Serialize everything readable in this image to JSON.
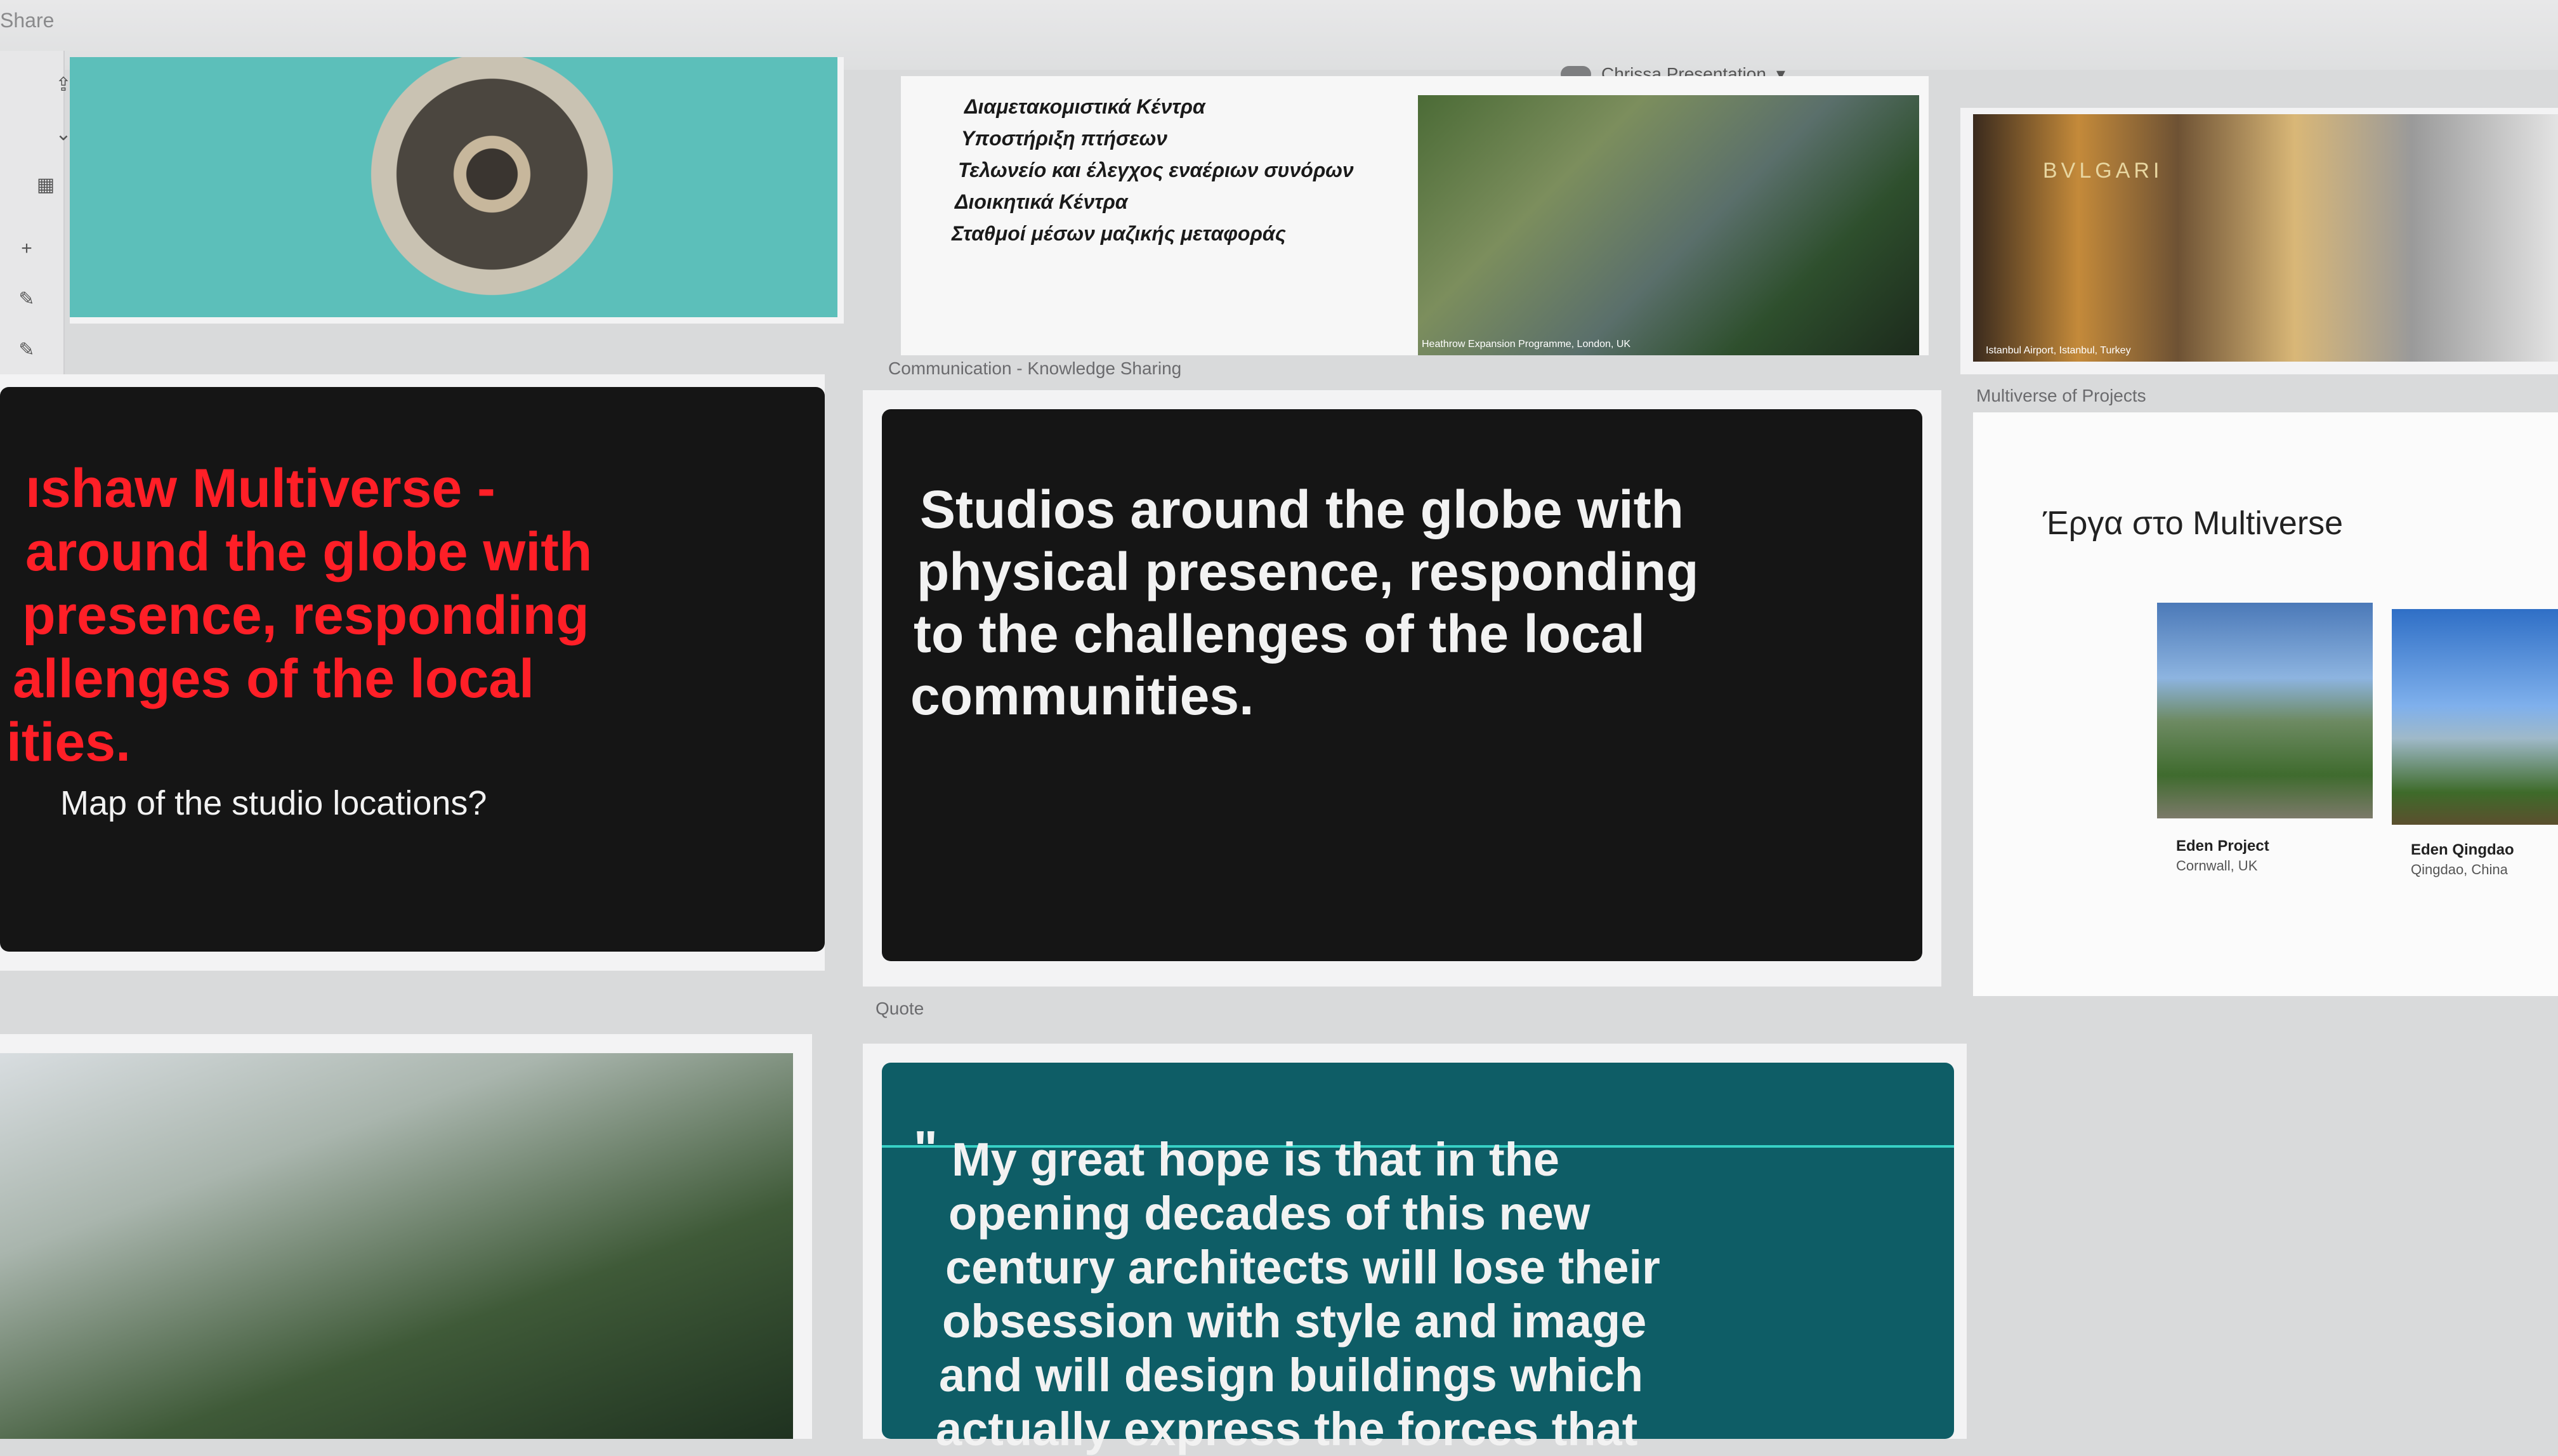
{
  "app": {
    "share_label": "Share",
    "document_name": "Chrissa Presentation"
  },
  "sections": {
    "communication": "Communication - Knowledge Sharing",
    "multiverse": "Multiverse of Projects",
    "quote": "Quote"
  },
  "slide_list": {
    "items": [
      "Διαμετακομιστικά Κέντρα",
      "Υποστήριξη πτήσεων",
      "Τελωνείο και έλεγχος εναέριων συνόρων",
      "Διοικητικά Κέντρα",
      "Σταθμοί μέσων μαζικής μεταφοράς"
    ]
  },
  "slide_red": {
    "lines": [
      "ıshaw Multiverse -",
      "around the globe with",
      "presence, responding",
      "allenges of the local",
      "ities."
    ],
    "subtitle": "Map of the studio locations?"
  },
  "slide_studios": {
    "lines": [
      "Studios around the globe with",
      "physical presence, responding",
      "to the challenges of the local",
      "communities."
    ]
  },
  "slide_projects": {
    "title": "Έργα στο Multiverse",
    "projects": [
      {
        "name": "Eden Project",
        "place": "Cornwall, UK"
      },
      {
        "name": "Eden Qingdao",
        "place": "Qingdao, China"
      }
    ]
  },
  "slide_quote": {
    "lines": [
      "My great hope is that in the",
      "opening decades of this new",
      "century architects will lose their",
      "obsession with style and image",
      "and will design buildings which",
      "actually express the forces that"
    ]
  },
  "image_caption_aerial": "Heathrow Expansion Programme, London, UK",
  "image_caption_mall": "Istanbul Airport, Istanbul, Turkey",
  "image_sign": "BVLGARI",
  "colors": {
    "accent_red": "#ff1f27",
    "teal": "#0e5d66",
    "slide_black": "#151515"
  }
}
